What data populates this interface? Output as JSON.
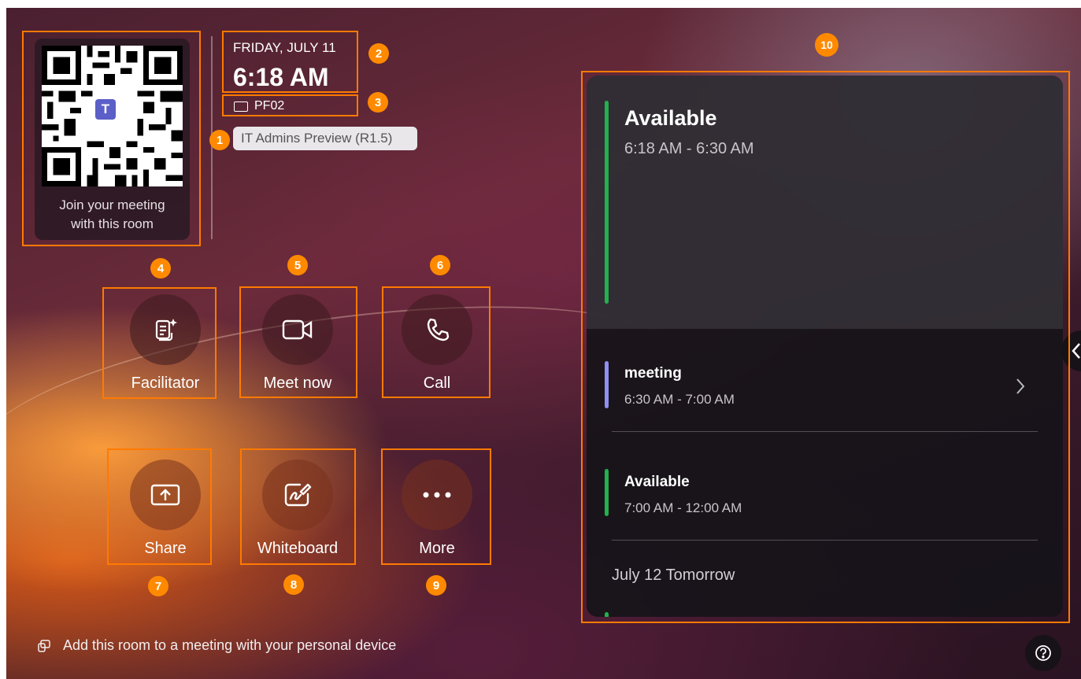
{
  "qr": {
    "caption_line1": "Join your meeting",
    "caption_line2": "with this room"
  },
  "header": {
    "date": "FRIDAY, JULY 11",
    "time": "6:18 AM",
    "room": "PF02",
    "preview_label": "IT Admins Preview (R1.5)"
  },
  "actions": [
    {
      "label": "Facilitator",
      "icon": "facilitator-icon"
    },
    {
      "label": "Meet now",
      "icon": "video-camera-icon"
    },
    {
      "label": "Call",
      "icon": "phone-icon"
    },
    {
      "label": "Share",
      "icon": "share-screen-icon"
    },
    {
      "label": "Whiteboard",
      "icon": "whiteboard-icon"
    },
    {
      "label": "More",
      "icon": "more-icon"
    }
  ],
  "badges": [
    "1",
    "2",
    "3",
    "4",
    "5",
    "6",
    "7",
    "8",
    "9",
    "10"
  ],
  "calendar": {
    "current": {
      "title": "Available",
      "time": "6:18 AM - 6:30 AM"
    },
    "events": [
      {
        "title": "meeting",
        "time": "6:30 AM - 7:00 AM"
      },
      {
        "title": "Available",
        "time": "7:00 AM - 12:00 AM"
      }
    ],
    "next_day_label": "July 12 Tomorrow"
  },
  "footer": {
    "text": "Add this room to a meeting with your personal device"
  },
  "colors": {
    "highlight": "#ff7a00",
    "available": "#22b14c",
    "meeting": "#8f8ff0"
  }
}
